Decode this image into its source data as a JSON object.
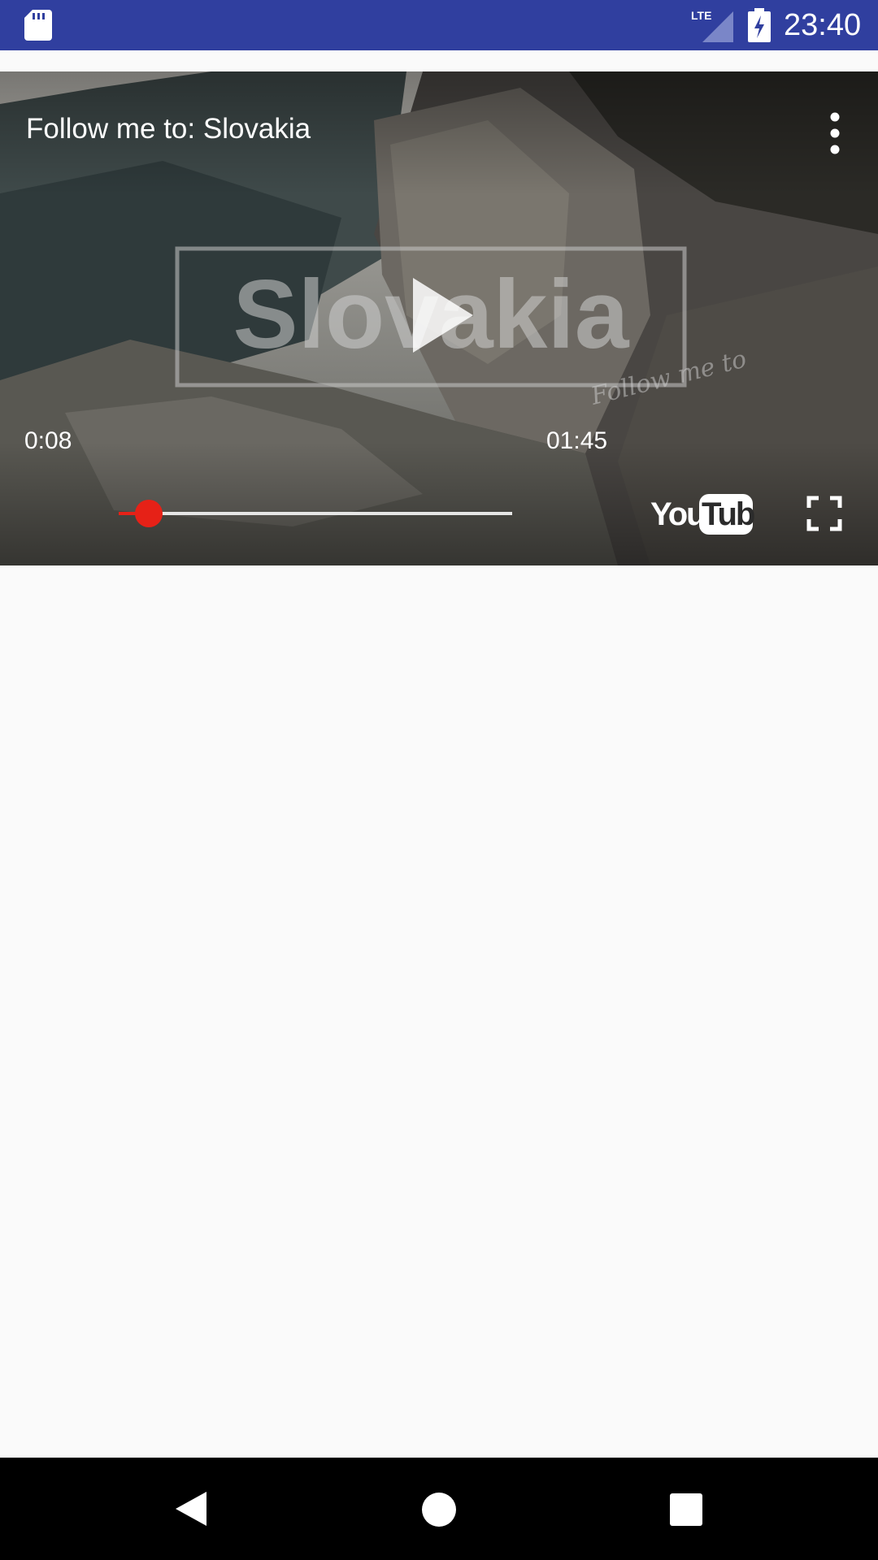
{
  "status_bar": {
    "time": "23:40",
    "network": "LTE",
    "icons": [
      "sd-card-icon",
      "lte-signal-icon",
      "battery-charging-icon"
    ],
    "background": "#303f9f"
  },
  "video": {
    "title": "Follow me to: Slovakia",
    "thumbnail_text": "Slovakia",
    "thumbnail_subtext": "Follow me to",
    "current_time": "0:08",
    "duration": "01:45",
    "progress_fraction": 0.076,
    "logo": "YouTube",
    "accent": "#e62117",
    "icons": [
      "more-vert-icon",
      "play-icon",
      "youtube-logo",
      "fullscreen-icon"
    ]
  },
  "nav_bar": {
    "icons": [
      "back-icon",
      "home-icon",
      "recents-icon"
    ]
  }
}
